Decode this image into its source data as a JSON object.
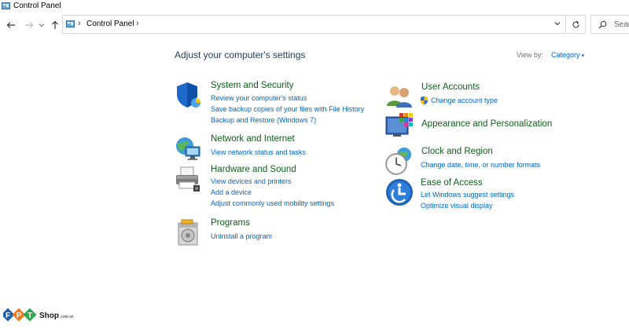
{
  "window": {
    "title": "Control Panel"
  },
  "address": {
    "crumb": "Control Panel",
    "separator": "›"
  },
  "search": {
    "placeholder": "Sear"
  },
  "main": {
    "heading": "Adjust your computer's settings",
    "view_by_label": "View by:",
    "view_by_value": "Category"
  },
  "categories": [
    {
      "title": "System and Security",
      "icon": "shield-icon",
      "links": [
        "Review your computer's status",
        "Save backup copies of your files with File History",
        "Backup and Restore (Windows 7)"
      ]
    },
    {
      "title": "Network and Internet",
      "icon": "network-globe-icon",
      "links": [
        "View network status and tasks"
      ]
    },
    {
      "title": "Hardware and Sound",
      "icon": "printer-icon",
      "links": [
        "View devices and printers",
        "Add a device",
        "Adjust commonly used mobility settings"
      ]
    },
    {
      "title": "Programs",
      "icon": "programs-icon",
      "links": [
        "Uninstall a program"
      ]
    },
    {
      "title": "User Accounts",
      "icon": "users-icon",
      "links": [
        "Change account type"
      ]
    },
    {
      "title": "Appearance and Personalization",
      "icon": "monitor-palette-icon",
      "links": []
    },
    {
      "title": "Clock and Region",
      "icon": "clock-globe-icon",
      "links": [
        "Change date, time, or number formats"
      ]
    },
    {
      "title": "Ease of Access",
      "icon": "ease-of-access-icon",
      "links": [
        "Let Windows suggest settings",
        "Optimize visual display"
      ]
    }
  ],
  "watermark": {
    "brand": "FPT",
    "shop": "Shop",
    "domain": ".com.vn"
  },
  "colors": {
    "heading": "#1e395b",
    "category_title": "#0c6118",
    "link": "#0066cc"
  }
}
